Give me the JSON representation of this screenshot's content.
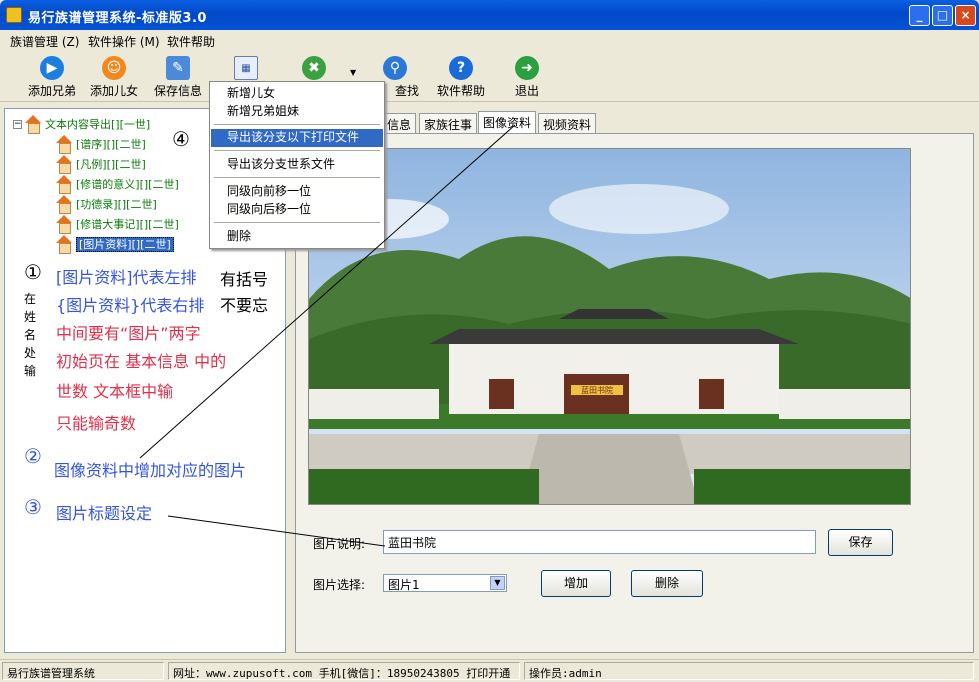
{
  "window": {
    "title": "易行族谱管理系统-标准版3.0"
  },
  "menubar": {
    "items": [
      "族谱管理 (Z)",
      "软件操作 (M)",
      "软件帮助"
    ]
  },
  "toolbar": {
    "buttons": [
      "添加兄弟",
      "添加儿女",
      "保存信息",
      "",
      "",
      "查找",
      "软件帮助",
      "退出"
    ]
  },
  "tree": {
    "root": "文本内容导出[][一世]",
    "items": [
      "[谱序][][二世]",
      "[凡例][][二世]",
      "[修谱的意义][][二世]",
      "[功德录][][二世]",
      "[修谱大事记][][二世]",
      "[图片资料][][二世]"
    ]
  },
  "annotations": {
    "n1": "①",
    "n2": "②",
    "n3": "③",
    "n4": "④",
    "line1": "[图片资料]代表左排",
    "line2": "{图片资料}代表右排",
    "line3": "中间要有“图片”两字",
    "line4": "初始页在 基本信息 中的",
    "line5": "世数 文本框中输",
    "line6": "只能输奇数",
    "side1": "有括号",
    "side2": "不要忘",
    "vertical": "在姓名处输",
    "a2": "图像资料中增加对应的图片",
    "a3": "图片标题设定"
  },
  "context_menu": {
    "items": [
      "新增儿女",
      "新增兄弟姐妹",
      "导出该分支以下打印文件",
      "导出该分支世系文件",
      "同级向前移一位",
      "同级向后移一位",
      "删除"
    ]
  },
  "tabs": {
    "items": [
      "信息",
      "家族往事",
      "图像资料",
      "视频资料"
    ],
    "active": "图像资料"
  },
  "image_panel": {
    "caption_label": "图片说明:",
    "caption_value": "蓝田书院",
    "save_button": "保存",
    "select_label": "图片选择:",
    "select_value": "图片1",
    "add_button": "增加",
    "delete_button": "删除",
    "gate_plaque": "蓝田书院"
  },
  "statusbar": {
    "app": "易行族谱管理系统",
    "info": "网址：www.zupusoft.com 手机[微信]：18950243805 打印开通",
    "operator": "操作员:admin"
  },
  "colors": {
    "annotation_blue": "#3355dd",
    "annotation_red": "#e0304a",
    "tree_green": "#0a7a0a",
    "title_blue": "#0453d6",
    "menu_highlight": "#316ac5"
  }
}
